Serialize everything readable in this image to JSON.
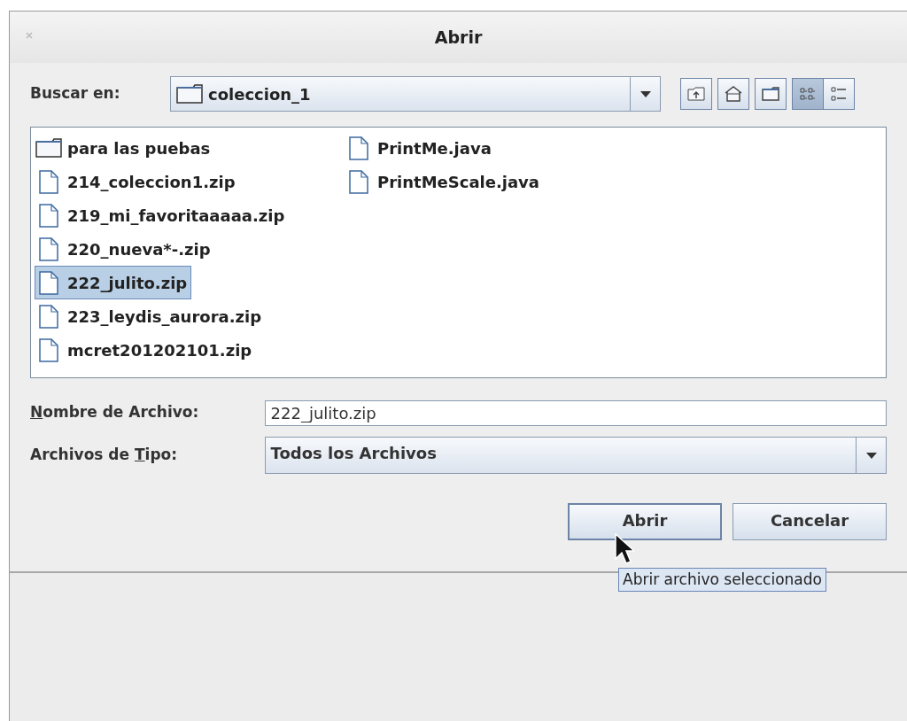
{
  "window": {
    "title": "Abrir"
  },
  "look_in": {
    "label": "Buscar en:",
    "value": "coleccion_1"
  },
  "toolbar": [
    {
      "kind": "up",
      "selected": false
    },
    {
      "kind": "home",
      "selected": false
    },
    {
      "kind": "new-folder",
      "selected": false
    },
    {
      "kind": "list-view",
      "selected": true
    },
    {
      "kind": "details-view",
      "selected": false
    }
  ],
  "files": [
    {
      "name": "para las puebas",
      "kind": "folder",
      "selected": false
    },
    {
      "name": "214_coleccion1.zip",
      "kind": "file",
      "selected": false
    },
    {
      "name": "219_mi_favoritaaaaa.zip",
      "kind": "file",
      "selected": false
    },
    {
      "name": "220_nueva*-.zip",
      "kind": "file",
      "selected": false
    },
    {
      "name": "222_julito.zip",
      "kind": "file",
      "selected": true
    },
    {
      "name": "223_leydis_aurora.zip",
      "kind": "file",
      "selected": false
    },
    {
      "name": "mcret201202101.zip",
      "kind": "file",
      "selected": false
    },
    {
      "name": "PrintMe.java",
      "kind": "file",
      "selected": false
    },
    {
      "name": "PrintMeScale.java",
      "kind": "file",
      "selected": false
    }
  ],
  "file_name": {
    "label": {
      "mnemonic": "N",
      "after": "ombre de Archivo:"
    },
    "value": "222_julito.zip"
  },
  "file_type": {
    "label": {
      "before": "Archivos de ",
      "mnemonic": "T",
      "after": "ipo:"
    },
    "value": "Todos los Archivos"
  },
  "buttons": [
    {
      "label": "Abrir",
      "kind": "default"
    },
    {
      "label": "Cancelar",
      "kind": "normal"
    }
  ],
  "tooltip": "Abrir archivo seleccionado"
}
